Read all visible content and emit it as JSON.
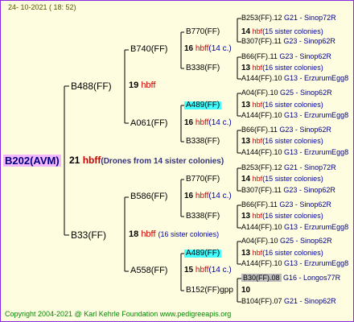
{
  "header": {
    "date": "24- 10-2021 ( 18: 52)"
  },
  "footer": {
    "text": "Copyright 2004-2021 @ Karl Kehrle Foundation    www.pedigreeapis.org"
  },
  "root": {
    "name": "B202(AVM)",
    "num": "21",
    "hb": "hbff",
    "note": "(Drones from 14 sister colonies)"
  },
  "g1": [
    {
      "name": "B488(FF)"
    },
    {
      "name": "B33(FF)"
    }
  ],
  "g2": [
    {
      "num": "19",
      "hb": "hbff",
      "note": ""
    },
    {
      "num": "18",
      "hb": "hbff",
      "note": "(16 sister colonies)"
    }
  ],
  "g2names": [
    {
      "name": "B740(FF)"
    },
    {
      "name": "A061(FF)"
    },
    {
      "name": "B586(FF)"
    },
    {
      "name": "A558(FF)"
    }
  ],
  "g3": [
    {
      "num": "16",
      "hb": "hbff",
      "note": "(14 c.)"
    },
    {
      "num": "16",
      "hb": "hbff",
      "note": "(14 c.)"
    },
    {
      "num": "16",
      "hb": "hbff",
      "note": "(14 c.)"
    },
    {
      "num": "15",
      "hb": "hbff",
      "note": "(14 c.)"
    }
  ],
  "g3names": [
    {
      "name": "B770(FF)"
    },
    {
      "name": "B338(FF)"
    },
    {
      "name": "A489(FF)"
    },
    {
      "name": "B338(FF)"
    },
    {
      "name": "B770(FF)"
    },
    {
      "name": "B338(FF)"
    },
    {
      "name": "A489(FF)"
    },
    {
      "name": "B152(FF)gpp"
    }
  ],
  "g4": [
    {
      "num": "14",
      "hb": "hbf",
      "note": "(15 sister colonies)"
    },
    {
      "num": "13",
      "hb": "hbf",
      "note": "(16 sister colonies)"
    },
    {
      "num": "13",
      "hb": "hbf",
      "note": "(16 sister colonies)"
    },
    {
      "num": "13",
      "hb": "hbf",
      "note": "(16 sister colonies)"
    },
    {
      "num": "14",
      "hb": "hbf",
      "note": "(15 sister colonies)"
    },
    {
      "num": "13",
      "hb": "hbf",
      "note": "(16 sister colonies)"
    },
    {
      "num": "13",
      "hb": "hbf",
      "note": "(16 sister colonies)"
    },
    {
      "num": "10",
      "hb": "",
      "note": ""
    }
  ],
  "g4names": [
    {
      "name": "B253(FF).12",
      "ng": "G21 - Sinop72R"
    },
    {
      "name": "B307(FF).11",
      "ng": "G23 - Sinop62R"
    },
    {
      "name": "B66(FF).11",
      "ng": "G23 - Sinop62R"
    },
    {
      "name": "A144(FF).10",
      "ng": "G13 - ErzurumEgg8"
    },
    {
      "name": "A04(FF).10",
      "ng": "G25 - Sinop62R"
    },
    {
      "name": "A144(FF).10",
      "ng": "G13 - ErzurumEgg8"
    },
    {
      "name": "B66(FF).11",
      "ng": "G23 - Sinop62R"
    },
    {
      "name": "A144(FF).10",
      "ng": "G13 - ErzurumEgg8"
    },
    {
      "name": "B253(FF).12",
      "ng": "G21 - Sinop72R"
    },
    {
      "name": "B307(FF).11",
      "ng": "G23 - Sinop62R"
    },
    {
      "name": "B66(FF).11",
      "ng": "G23 - Sinop62R"
    },
    {
      "name": "A144(FF).10",
      "ng": "G13 - ErzurumEgg8"
    },
    {
      "name": "A04(FF).10",
      "ng": "G25 - Sinop62R"
    },
    {
      "name": "A144(FF).10",
      "ng": "G13 - ErzurumEgg8"
    },
    {
      "name": "B30(FF).08",
      "ng": "G16 - Longos77R"
    },
    {
      "name": "B104(FF).07",
      "ng": "G21 - Sinop62R"
    }
  ]
}
